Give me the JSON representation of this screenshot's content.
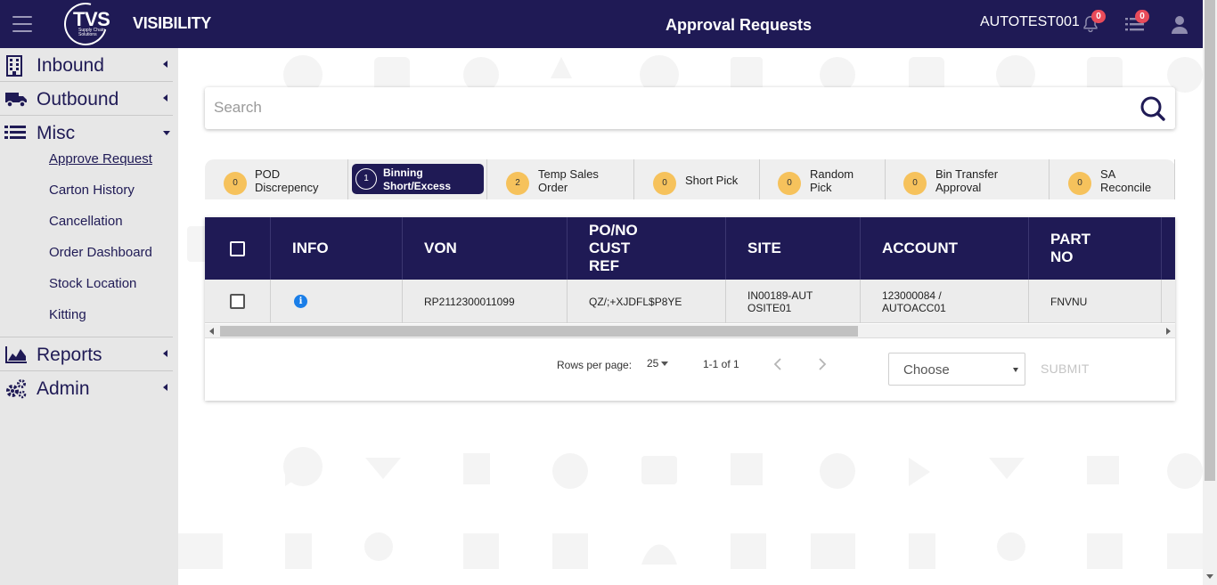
{
  "header": {
    "logo_text": "TVS",
    "logo_sub": "Supply Chain Solutions",
    "brand": "VISIBILITY",
    "page_title": "Approval Requests",
    "username": "AUTOTEST001",
    "notifications_count": "0",
    "tasks_count": "0"
  },
  "sidebar": {
    "inbound": "Inbound",
    "outbound": "Outbound",
    "misc": "Misc",
    "misc_items": [
      "Approve Request",
      "Carton History",
      "Cancellation",
      "Order Dashboard",
      "Stock Location",
      "Kitting"
    ],
    "reports": "Reports",
    "admin": "Admin"
  },
  "search": {
    "placeholder": "Search"
  },
  "tabs": [
    {
      "count": "0",
      "label": "POD Discrepency"
    },
    {
      "count": "1",
      "label": "Binning Short/Excess"
    },
    {
      "count": "2",
      "label": "Temp Sales Order"
    },
    {
      "count": "0",
      "label": "Short Pick"
    },
    {
      "count": "0",
      "label": "Random Pick"
    },
    {
      "count": "0",
      "label": "Bin Transfer Approval"
    },
    {
      "count": "0",
      "label": "SA Reconcile"
    }
  ],
  "table": {
    "columns": [
      "INFO",
      "VON",
      "PO/NO CUST REF",
      "SITE",
      "ACCOUNT",
      "PART NO"
    ],
    "rows": [
      {
        "info": "i",
        "von": "RP2112300011099",
        "po_no_cust_ref": "QZ/;+XJDFL$P8YE",
        "site": "IN00189-AUTOSITE01",
        "account": "123000084 / AUTOACC01",
        "part_no": "FNVNU"
      }
    ]
  },
  "pagination": {
    "rows_per_page_label": "Rows per page:",
    "rows_per_page": "25",
    "range": "1-1 of 1"
  },
  "action": {
    "choose_value": "Choose",
    "submit_label": "SUBMIT"
  },
  "colors": {
    "primary": "#1f1a55",
    "badge": "#e94b5a",
    "count_chip": "#f6c25c",
    "info": "#1a7ee8"
  }
}
